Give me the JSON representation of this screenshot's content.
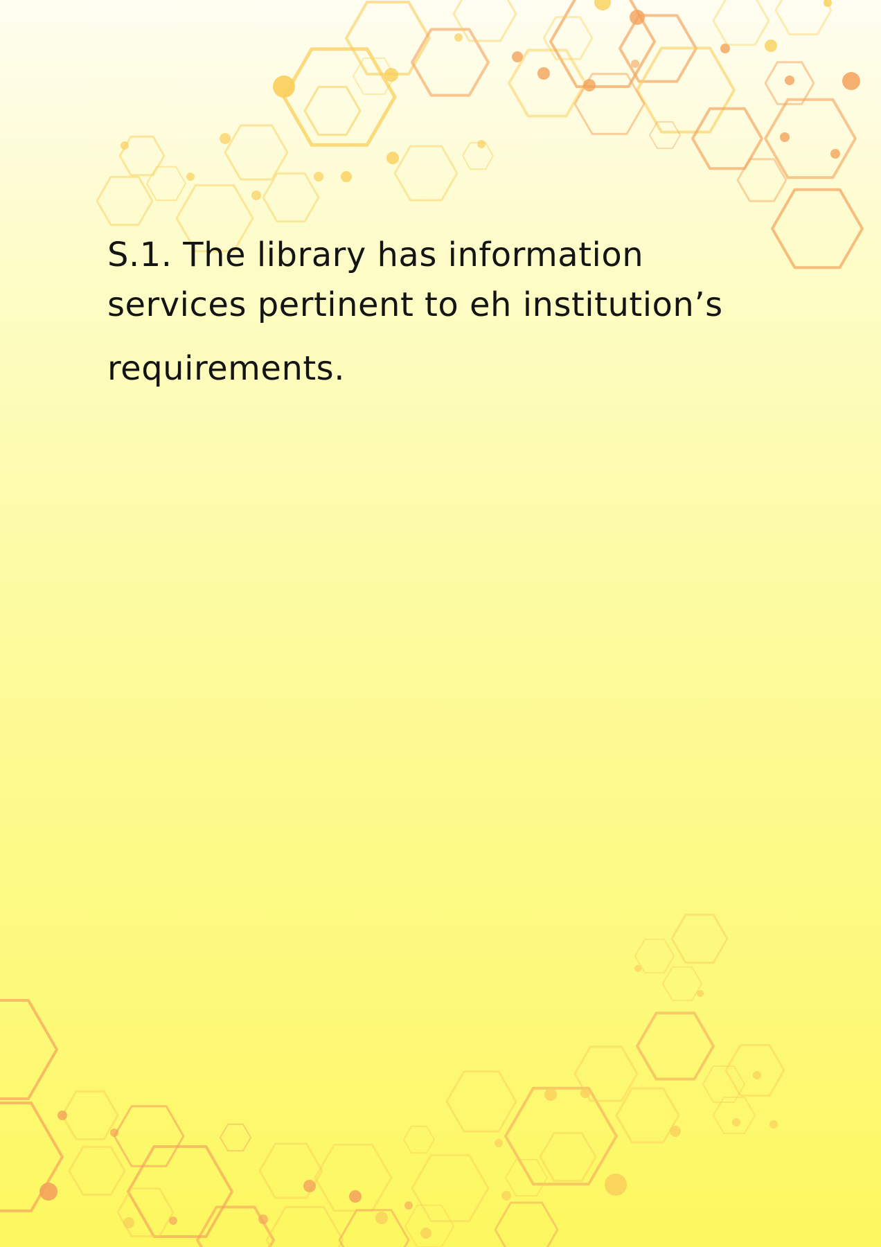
{
  "document": {
    "heading_lines": [
      "S.1. The library has information",
      "services pertinent to eh institution’s",
      "requirements."
    ]
  },
  "colors": {
    "background_top": "#fefdf1",
    "background_bottom": "#fdf75f",
    "hex_yellow": "#f9cf5b",
    "hex_orange": "#f3a25b",
    "hex_coral": "#f08a5d",
    "text": "#141414"
  },
  "icons": [
    "hexagon-network-pattern"
  ]
}
